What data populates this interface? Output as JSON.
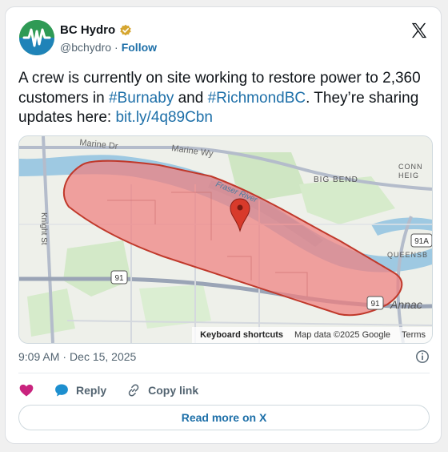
{
  "author": {
    "display_name": "BC Hydro",
    "handle": "@bchydro",
    "separator": "·",
    "follow_label": "Follow"
  },
  "tweet": {
    "text_part1": "A crew is currently on site working to restore power to 2,360 customers in ",
    "hashtag1": "#Burnaby",
    "text_part2": " and ",
    "hashtag2": "#RichmondBC",
    "text_part3": ". They’re sharing updates here: ",
    "link": "bit.ly/4q89Cbn"
  },
  "map": {
    "labels": {
      "marine_dr": "Marine Dr",
      "marine_wy": "Marine Wy",
      "fraser_river": "Fraser River",
      "big_bend": "BIG BEND",
      "connaught_heights": "CONN\nHEIG",
      "knight_st": "Knight St",
      "queensborough": "QUEENSB",
      "annacis": "Annac",
      "route_91": "91",
      "route_91a": "91A"
    },
    "footer": {
      "keyboard_shortcuts": "Keyboard shortcuts",
      "map_data": "Map data ©2025 Google",
      "terms": "Terms"
    },
    "colors": {
      "outage_fill": "#f08080",
      "outage_stroke": "#c0392b",
      "water": "#9ec9e2",
      "marker": "#d83a2b"
    }
  },
  "timestamp": {
    "time": "9:09 AM",
    "separator": "·",
    "date": "Dec 15, 2025"
  },
  "actions": {
    "reply_label": "Reply",
    "copy_label": "Copy link"
  },
  "read_more_label": "Read more on X",
  "colors": {
    "link": "#1d6fa8",
    "heart": "#c9247e",
    "reply_bubble": "#1d8fcf"
  }
}
